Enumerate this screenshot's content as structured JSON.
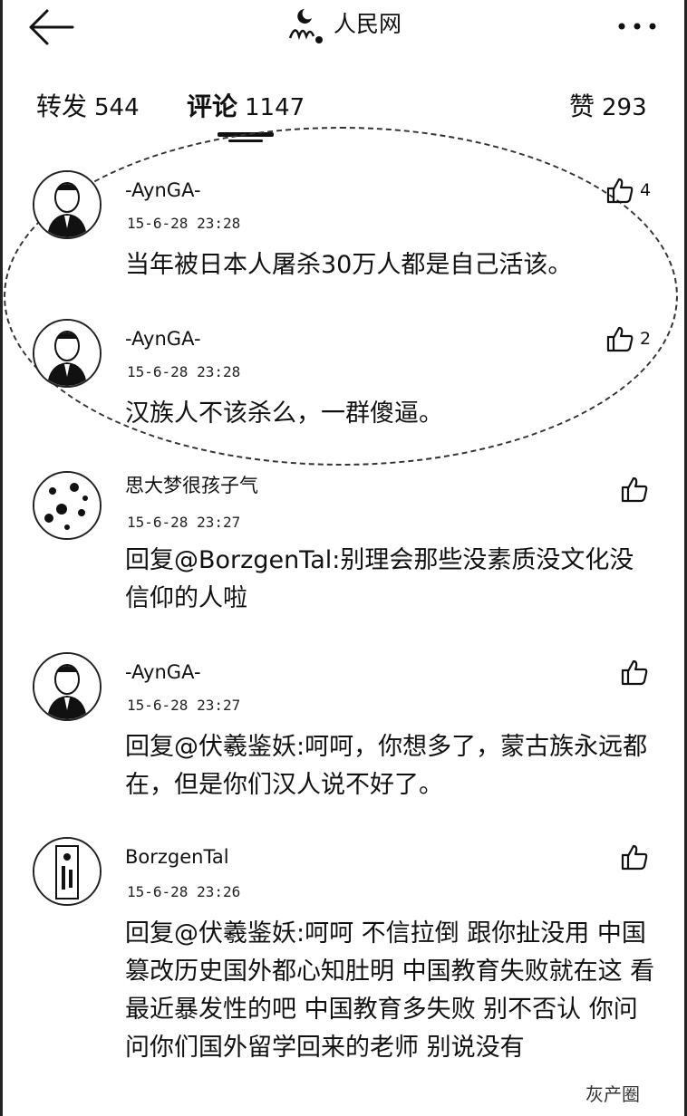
{
  "header": {
    "title": "人民网",
    "back_icon": "arrow-left-icon",
    "more_icon": "more-dots-icon"
  },
  "tabs": [
    {
      "label": "转发",
      "count": "544"
    },
    {
      "label": "评论",
      "count": "1147"
    },
    {
      "label": "赞",
      "count": "293"
    }
  ],
  "comments": [
    {
      "user": "-AynGA-",
      "time": "15-6-28 23:28",
      "likes": "4",
      "text": "当年被日本人屠杀30万人都是自己活该。"
    },
    {
      "user": "-AynGA-",
      "time": "15-6-28 23:28",
      "likes": "2",
      "text": "汉族人不该杀么，一群傻逼。"
    },
    {
      "user": "思大梦很孩子气",
      "time": "15-6-28 23:27",
      "likes": "",
      "text": "回复@BorzgenTal:别理会那些没素质没文化没信仰的人啦"
    },
    {
      "user": "-AynGA-",
      "time": "15-6-28 23:27",
      "likes": "",
      "text": "回复@伏羲鉴妖:呵呵，你想多了，蒙古族永远都在，但是你们汉人说不好了。"
    },
    {
      "user": "BorzgenTal",
      "time": "15-6-28 23:26",
      "likes": "",
      "text": "回复@伏羲鉴妖:呵呵 不信拉倒 跟你扯没用 中国篡改历史国外都心知肚明 中国教育失败就在这 看最近暴发性的吧 中国教育多失败 别不否认 你问问你们国外留学回来的老师 别说没有"
    }
  ],
  "watermark": {
    "right": "灰产圈"
  }
}
